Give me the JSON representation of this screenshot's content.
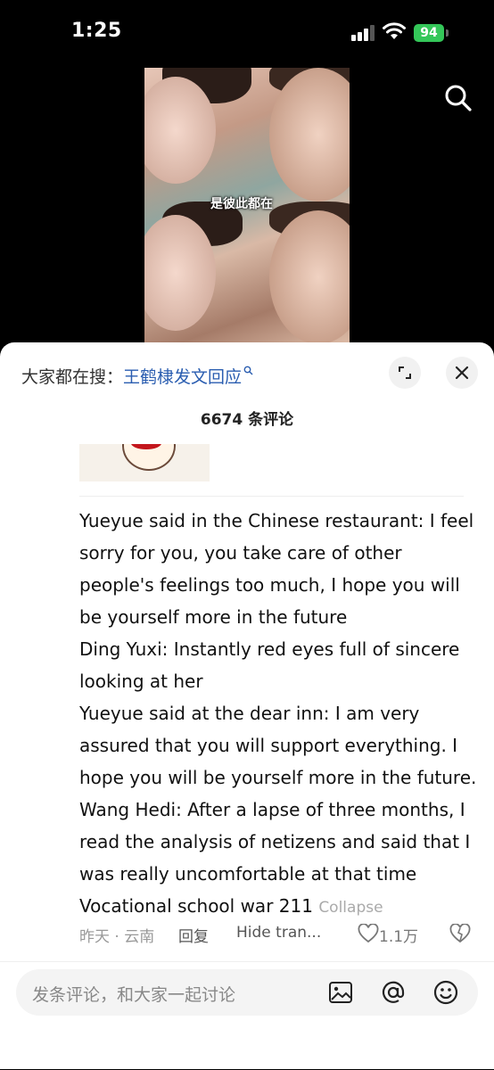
{
  "status_bar": {
    "time": "1:25",
    "battery": "94"
  },
  "video": {
    "subtitle": "是彼此都在"
  },
  "sheet": {
    "trending_prefix": "大家都在搜：",
    "trending_link": "王鹤棣发文回应",
    "comment_count": "6674 条评论"
  },
  "comment": {
    "lines": [
      "Yueyue said in the Chinese restaurant: I feel",
      "sorry for you, you take care of other",
      "people's feelings too much, I hope you will",
      "be yourself more in the future",
      "Ding Yuxi: Instantly red eyes full of sincere",
      "looking at her",
      "Yueyue said at the dear inn: I am very",
      "assured that you will support everything. I",
      "hope you will be yourself more in the future.",
      "Wang Hedi: After a lapse of three months, I",
      "read the analysis of netizens and said that I",
      "was really uncomfortable at that time",
      "Vocational school war 211"
    ],
    "collapse_label": "Collapse",
    "time_location": "昨天 · 云南",
    "reply_label": "回复",
    "hide_translation_label": "Hide tran...",
    "like_count": "1.1万"
  },
  "input": {
    "placeholder": "发条评论，和大家一起讨论"
  },
  "icons": [
    "search-icon",
    "expand-icon",
    "close-icon",
    "heart-icon",
    "dislike-icon",
    "image-icon",
    "mention-icon",
    "emoji-icon"
  ],
  "colors": {
    "link": "#2a5db0",
    "battery": "#34c759"
  }
}
